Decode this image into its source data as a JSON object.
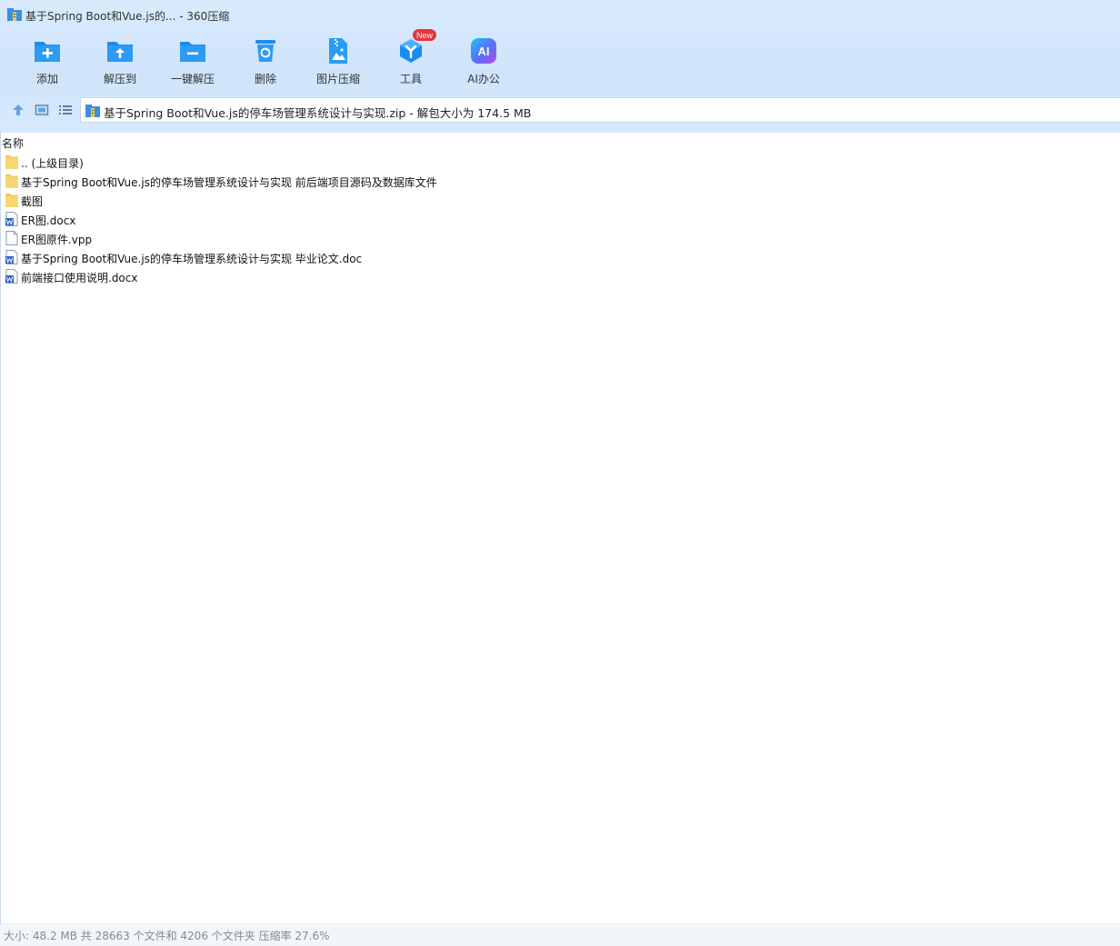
{
  "window": {
    "title": "基于Spring Boot和Vue.js的... - 360压缩"
  },
  "toolbar": {
    "items": [
      {
        "label": "添加",
        "icon": "add-folder-icon"
      },
      {
        "label": "解压到",
        "icon": "extract-to-icon"
      },
      {
        "label": "一键解压",
        "icon": "one-click-extract-icon"
      },
      {
        "label": "删除",
        "icon": "delete-icon"
      },
      {
        "label": "图片压缩",
        "icon": "image-compress-icon"
      },
      {
        "label": "工具",
        "icon": "tools-icon",
        "badge": "New"
      },
      {
        "label": "AI办公",
        "icon": "ai-office-icon",
        "icon_text": "AI"
      }
    ]
  },
  "address": {
    "path": "基于Spring Boot和Vue.js的停车场管理系统设计与实现.zip - 解包大小为 174.5 MB"
  },
  "list": {
    "column_name": "名称",
    "items": [
      {
        "name": ".. (上级目录)",
        "type": "folder"
      },
      {
        "name": "基于Spring Boot和Vue.js的停车场管理系统设计与实现 前后端项目源码及数据库文件",
        "type": "folder"
      },
      {
        "name": "截图",
        "type": "folder"
      },
      {
        "name": "ER图.docx",
        "type": "word"
      },
      {
        "name": "ER图原件.vpp",
        "type": "file"
      },
      {
        "name": "基于Spring Boot和Vue.js的停车场管理系统设计与实现 毕业论文.doc",
        "type": "word"
      },
      {
        "name": "前端接口使用说明.docx",
        "type": "word"
      }
    ]
  },
  "status": {
    "text": "大小: 48.2 MB 共 28663 个文件和 4206 个文件夹 压缩率 27.6%"
  },
  "colors": {
    "accent": "#1a8cf0",
    "folder": "#f7d774",
    "word": "#2b5fc9",
    "badge": "#e8323c"
  }
}
